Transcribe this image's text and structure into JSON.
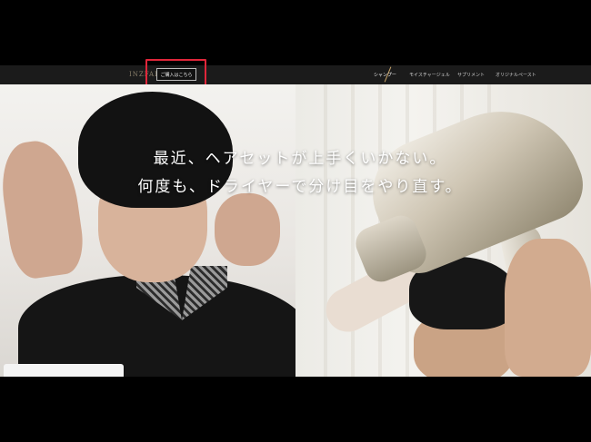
{
  "header": {
    "logo_text": "INZFAL",
    "buy_button_label": "ご購入はこちら",
    "nav": [
      {
        "label": "シャンプー",
        "active": true
      },
      {
        "label": "モイスチャージェル",
        "active": false
      },
      {
        "label": "サプリメント",
        "active": false
      },
      {
        "label": "オリジナルペースト",
        "active": false
      }
    ]
  },
  "hero": {
    "headline_line1": "最近、ヘアセットが上手くいかない。",
    "headline_line2": "何度も、ドライヤーで分け目をやり直す。"
  },
  "colors": {
    "highlight": "#e0263a",
    "topbar": "#1b1b1b",
    "accent": "#c9a56a"
  }
}
